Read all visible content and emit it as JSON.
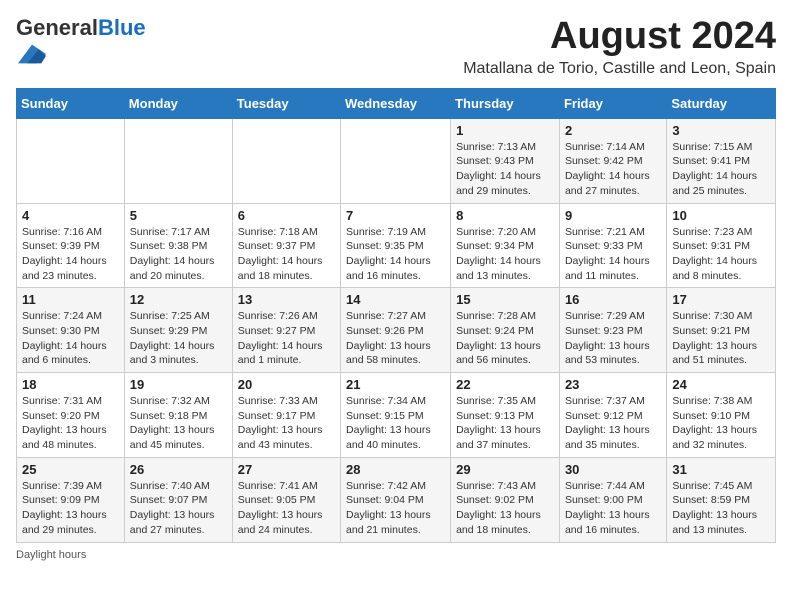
{
  "logo": {
    "general": "General",
    "blue": "Blue"
  },
  "title": {
    "month_year": "August 2024",
    "location": "Matallana de Torio, Castille and Leon, Spain"
  },
  "weekdays": [
    "Sunday",
    "Monday",
    "Tuesday",
    "Wednesday",
    "Thursday",
    "Friday",
    "Saturday"
  ],
  "weeks": [
    [
      {
        "day": "",
        "info": ""
      },
      {
        "day": "",
        "info": ""
      },
      {
        "day": "",
        "info": ""
      },
      {
        "day": "",
        "info": ""
      },
      {
        "day": "1",
        "info": "Sunrise: 7:13 AM\nSunset: 9:43 PM\nDaylight: 14 hours\nand 29 minutes."
      },
      {
        "day": "2",
        "info": "Sunrise: 7:14 AM\nSunset: 9:42 PM\nDaylight: 14 hours\nand 27 minutes."
      },
      {
        "day": "3",
        "info": "Sunrise: 7:15 AM\nSunset: 9:41 PM\nDaylight: 14 hours\nand 25 minutes."
      }
    ],
    [
      {
        "day": "4",
        "info": "Sunrise: 7:16 AM\nSunset: 9:39 PM\nDaylight: 14 hours\nand 23 minutes."
      },
      {
        "day": "5",
        "info": "Sunrise: 7:17 AM\nSunset: 9:38 PM\nDaylight: 14 hours\nand 20 minutes."
      },
      {
        "day": "6",
        "info": "Sunrise: 7:18 AM\nSunset: 9:37 PM\nDaylight: 14 hours\nand 18 minutes."
      },
      {
        "day": "7",
        "info": "Sunrise: 7:19 AM\nSunset: 9:35 PM\nDaylight: 14 hours\nand 16 minutes."
      },
      {
        "day": "8",
        "info": "Sunrise: 7:20 AM\nSunset: 9:34 PM\nDaylight: 14 hours\nand 13 minutes."
      },
      {
        "day": "9",
        "info": "Sunrise: 7:21 AM\nSunset: 9:33 PM\nDaylight: 14 hours\nand 11 minutes."
      },
      {
        "day": "10",
        "info": "Sunrise: 7:23 AM\nSunset: 9:31 PM\nDaylight: 14 hours\nand 8 minutes."
      }
    ],
    [
      {
        "day": "11",
        "info": "Sunrise: 7:24 AM\nSunset: 9:30 PM\nDaylight: 14 hours\nand 6 minutes."
      },
      {
        "day": "12",
        "info": "Sunrise: 7:25 AM\nSunset: 9:29 PM\nDaylight: 14 hours\nand 3 minutes."
      },
      {
        "day": "13",
        "info": "Sunrise: 7:26 AM\nSunset: 9:27 PM\nDaylight: 14 hours\nand 1 minute."
      },
      {
        "day": "14",
        "info": "Sunrise: 7:27 AM\nSunset: 9:26 PM\nDaylight: 13 hours\nand 58 minutes."
      },
      {
        "day": "15",
        "info": "Sunrise: 7:28 AM\nSunset: 9:24 PM\nDaylight: 13 hours\nand 56 minutes."
      },
      {
        "day": "16",
        "info": "Sunrise: 7:29 AM\nSunset: 9:23 PM\nDaylight: 13 hours\nand 53 minutes."
      },
      {
        "day": "17",
        "info": "Sunrise: 7:30 AM\nSunset: 9:21 PM\nDaylight: 13 hours\nand 51 minutes."
      }
    ],
    [
      {
        "day": "18",
        "info": "Sunrise: 7:31 AM\nSunset: 9:20 PM\nDaylight: 13 hours\nand 48 minutes."
      },
      {
        "day": "19",
        "info": "Sunrise: 7:32 AM\nSunset: 9:18 PM\nDaylight: 13 hours\nand 45 minutes."
      },
      {
        "day": "20",
        "info": "Sunrise: 7:33 AM\nSunset: 9:17 PM\nDaylight: 13 hours\nand 43 minutes."
      },
      {
        "day": "21",
        "info": "Sunrise: 7:34 AM\nSunset: 9:15 PM\nDaylight: 13 hours\nand 40 minutes."
      },
      {
        "day": "22",
        "info": "Sunrise: 7:35 AM\nSunset: 9:13 PM\nDaylight: 13 hours\nand 37 minutes."
      },
      {
        "day": "23",
        "info": "Sunrise: 7:37 AM\nSunset: 9:12 PM\nDaylight: 13 hours\nand 35 minutes."
      },
      {
        "day": "24",
        "info": "Sunrise: 7:38 AM\nSunset: 9:10 PM\nDaylight: 13 hours\nand 32 minutes."
      }
    ],
    [
      {
        "day": "25",
        "info": "Sunrise: 7:39 AM\nSunset: 9:09 PM\nDaylight: 13 hours\nand 29 minutes."
      },
      {
        "day": "26",
        "info": "Sunrise: 7:40 AM\nSunset: 9:07 PM\nDaylight: 13 hours\nand 27 minutes."
      },
      {
        "day": "27",
        "info": "Sunrise: 7:41 AM\nSunset: 9:05 PM\nDaylight: 13 hours\nand 24 minutes."
      },
      {
        "day": "28",
        "info": "Sunrise: 7:42 AM\nSunset: 9:04 PM\nDaylight: 13 hours\nand 21 minutes."
      },
      {
        "day": "29",
        "info": "Sunrise: 7:43 AM\nSunset: 9:02 PM\nDaylight: 13 hours\nand 18 minutes."
      },
      {
        "day": "30",
        "info": "Sunrise: 7:44 AM\nSunset: 9:00 PM\nDaylight: 13 hours\nand 16 minutes."
      },
      {
        "day": "31",
        "info": "Sunrise: 7:45 AM\nSunset: 8:59 PM\nDaylight: 13 hours\nand 13 minutes."
      }
    ]
  ],
  "footer": {
    "daylight_label": "Daylight hours"
  }
}
